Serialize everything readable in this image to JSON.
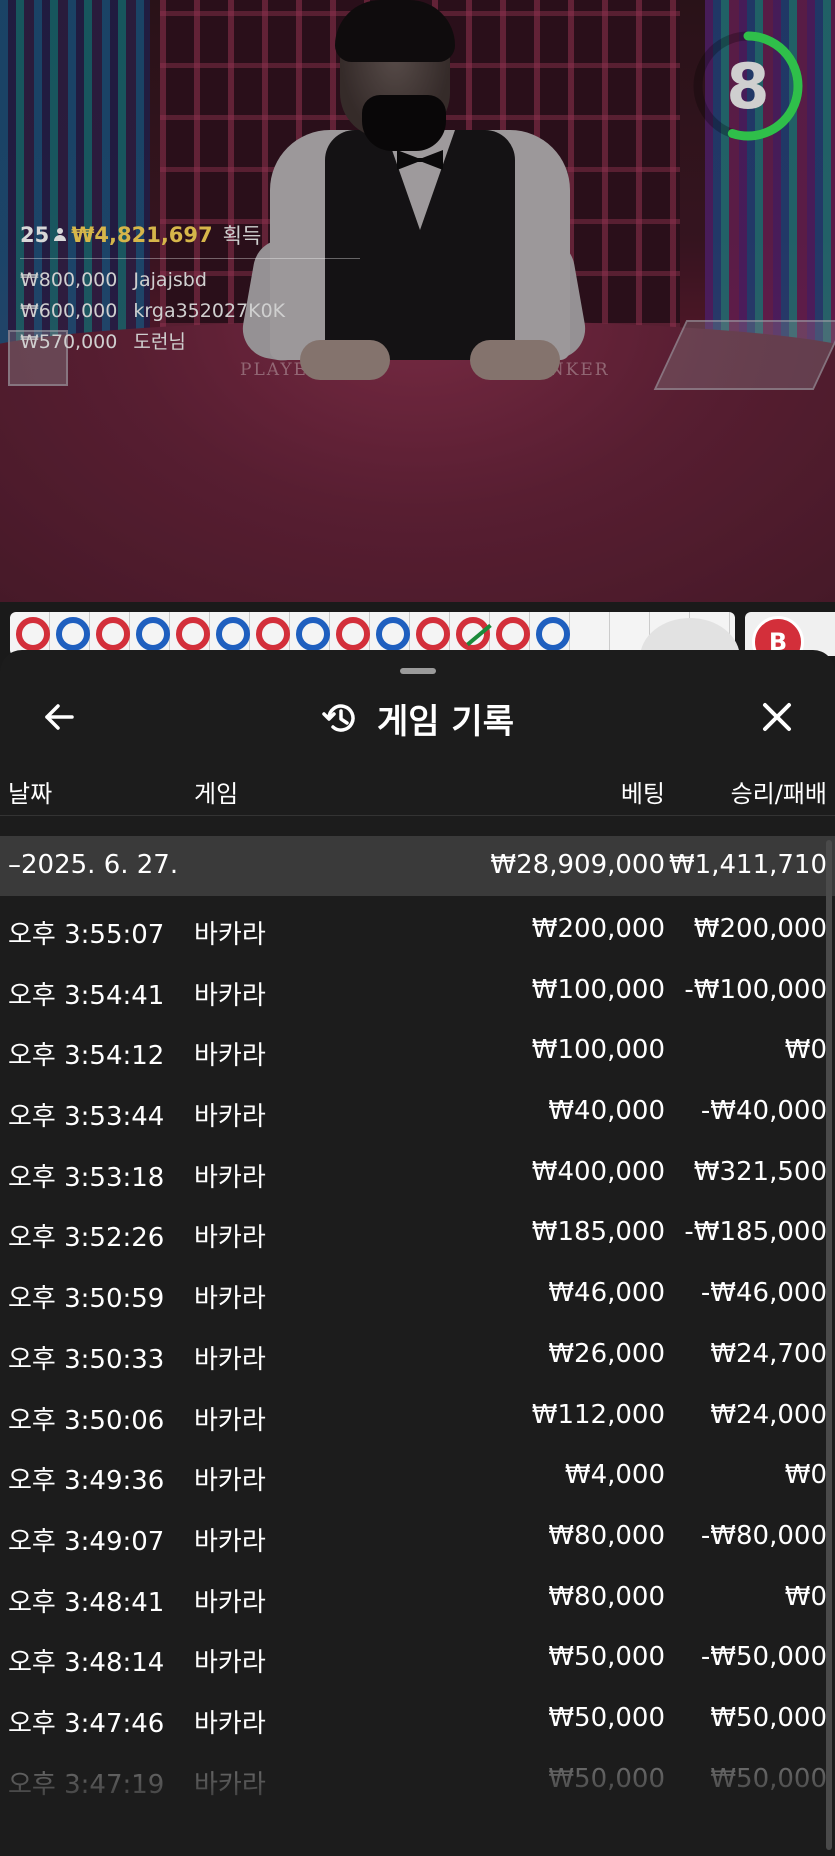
{
  "video": {
    "timer_value": "8",
    "timer_fraction_remaining": 0.55,
    "timer_color": "#2fbf4a",
    "felt_left_text": "PLAYER",
    "felt_right_text": "BANKER",
    "winners": {
      "count": "25",
      "total": "₩4,821,697",
      "label": "획득",
      "list": [
        {
          "amount": "₩800,000",
          "name": "Jajajsbd"
        },
        {
          "amount": "₩600,000",
          "name": "krga352027K0K"
        },
        {
          "amount": "₩570,000",
          "name": "도런님"
        }
      ]
    }
  },
  "road": {
    "beads": [
      "r",
      "b",
      "r",
      "b",
      "r",
      "b",
      "r",
      "b",
      "r",
      "b",
      "r",
      "tie",
      "r",
      "b"
    ],
    "badge": "B"
  },
  "sheet": {
    "title": "게임 기록",
    "back_icon": "arrow-left-icon",
    "history_icon": "history-icon",
    "close_icon": "close-icon",
    "columns": {
      "date": "날짜",
      "game": "게임",
      "bet": "베팅",
      "result": "승리/패배"
    },
    "date_group": {
      "date": "–2025. 6. 27.",
      "bet_total": "₩28,909,000",
      "result_total": "₩1,411,710"
    },
    "rows": [
      {
        "time": "오후 3:55:07",
        "game": "바카라",
        "bet": "₩200,000",
        "result": "₩200,000"
      },
      {
        "time": "오후 3:54:41",
        "game": "바카라",
        "bet": "₩100,000",
        "result": "-₩100,000"
      },
      {
        "time": "오후 3:54:12",
        "game": "바카라",
        "bet": "₩100,000",
        "result": "₩0"
      },
      {
        "time": "오후 3:53:44",
        "game": "바카라",
        "bet": "₩40,000",
        "result": "-₩40,000"
      },
      {
        "time": "오후 3:53:18",
        "game": "바카라",
        "bet": "₩400,000",
        "result": "₩321,500"
      },
      {
        "time": "오후 3:52:26",
        "game": "바카라",
        "bet": "₩185,000",
        "result": "-₩185,000"
      },
      {
        "time": "오후 3:50:59",
        "game": "바카라",
        "bet": "₩46,000",
        "result": "-₩46,000"
      },
      {
        "time": "오후 3:50:33",
        "game": "바카라",
        "bet": "₩26,000",
        "result": "₩24,700"
      },
      {
        "time": "오후 3:50:06",
        "game": "바카라",
        "bet": "₩112,000",
        "result": "₩24,000"
      },
      {
        "time": "오후 3:49:36",
        "game": "바카라",
        "bet": "₩4,000",
        "result": "₩0"
      },
      {
        "time": "오후 3:49:07",
        "game": "바카라",
        "bet": "₩80,000",
        "result": "-₩80,000"
      },
      {
        "time": "오후 3:48:41",
        "game": "바카라",
        "bet": "₩80,000",
        "result": "₩0"
      },
      {
        "time": "오후 3:48:14",
        "game": "바카라",
        "bet": "₩50,000",
        "result": "-₩50,000"
      },
      {
        "time": "오후 3:47:46",
        "game": "바카라",
        "bet": "₩50,000",
        "result": "₩50,000"
      },
      {
        "time": "오후 3:47:19",
        "game": "바카라",
        "bet": "₩50,000",
        "result": "₩50,000"
      }
    ]
  }
}
